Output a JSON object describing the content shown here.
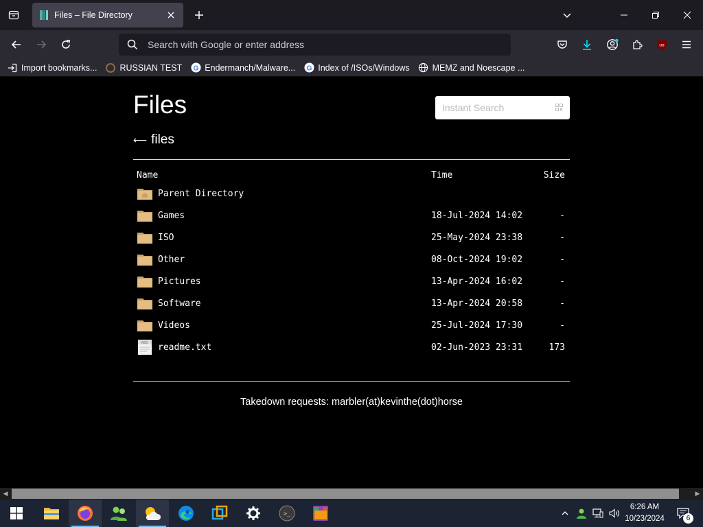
{
  "browser": {
    "tab": {
      "title": "Files – File Directory"
    },
    "urlbar": {
      "placeholder": "Search with Google or enter address"
    },
    "bookmarks": [
      {
        "label": "Import bookmarks...",
        "icon": "import-icon"
      },
      {
        "label": "RUSSIAN TEST",
        "icon": "site-icon"
      },
      {
        "label": "Endermanch/Malware...",
        "icon": "google-icon"
      },
      {
        "label": "Index of /ISOs/Windows",
        "icon": "google-icon"
      },
      {
        "label": "MEMZ and Noescape ...",
        "icon": "globe-icon"
      }
    ],
    "accent_color": "#0df"
  },
  "page": {
    "title": "Files",
    "search_placeholder": "Instant Search",
    "breadcrumb": {
      "arrow": "⟵",
      "label": "files"
    },
    "columns": {
      "name": "Name",
      "time": "Time",
      "size": "Size"
    },
    "rows": [
      {
        "name": "Parent Directory",
        "time": "",
        "size": "",
        "icon": "parent-folder-icon"
      },
      {
        "name": "Games",
        "time": "18-Jul-2024 14:02",
        "size": "-",
        "icon": "folder-icon"
      },
      {
        "name": "ISO",
        "time": "25-May-2024 23:38",
        "size": "-",
        "icon": "folder-icon"
      },
      {
        "name": "Other",
        "time": "08-Oct-2024 19:02",
        "size": "-",
        "icon": "folder-icon"
      },
      {
        "name": "Pictures",
        "time": "13-Apr-2024 16:02",
        "size": "-",
        "icon": "folder-icon"
      },
      {
        "name": "Software",
        "time": "13-Apr-2024 20:58",
        "size": "-",
        "icon": "folder-icon"
      },
      {
        "name": "Videos",
        "time": "25-Jul-2024 17:30",
        "size": "-",
        "icon": "folder-icon"
      },
      {
        "name": "readme.txt",
        "time": "02-Jun-2023 23:31",
        "size": "173",
        "icon": "text-file-icon"
      }
    ],
    "footer": "Takedown requests: marbler(at)kevinthe(dot)horse"
  },
  "taskbar": {
    "apps": [
      "file-explorer-icon",
      "firefox-icon",
      "people-icon",
      "weather-icon",
      "edge-icon",
      "virtual-machine-icon",
      "settings-icon",
      "terminal-icon",
      "media-app-icon"
    ],
    "clock": {
      "time": "6:26 AM",
      "date": "10/23/2024"
    },
    "notification_count": "6"
  }
}
